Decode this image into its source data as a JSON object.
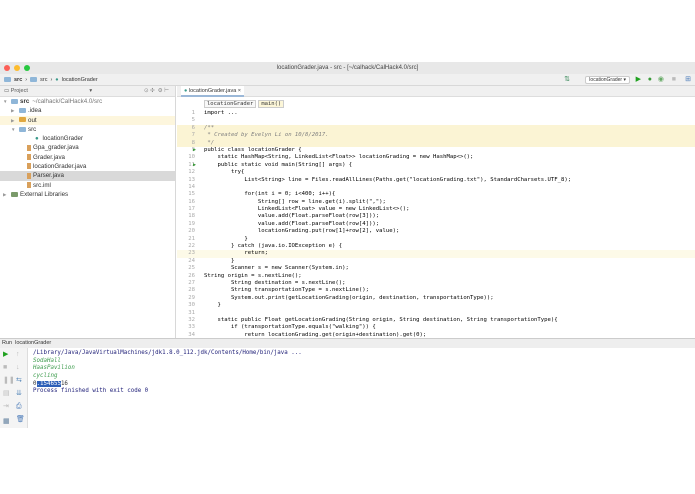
{
  "window": {
    "title": "locationGrader.java - src - [~/calhack/CalHack4.0/src]"
  },
  "navbar": {
    "crumbs": [
      "src",
      "src",
      "locationGrader"
    ],
    "run_config": "locationGrader"
  },
  "project": {
    "header": "Project",
    "tree": [
      {
        "label": "src",
        "suffix": "~/calhack/CalHack4.0/src",
        "indent": 0,
        "type": "folder",
        "arrow": "▼",
        "state": ""
      },
      {
        "label": ".idea",
        "indent": 1,
        "type": "folder",
        "arrow": "▶",
        "state": ""
      },
      {
        "label": "out",
        "indent": 1,
        "type": "folder-orange",
        "arrow": "▶",
        "state": "hl"
      },
      {
        "label": "src",
        "indent": 1,
        "type": "folder",
        "arrow": "▼",
        "state": ""
      },
      {
        "label": "locationGrader",
        "indent": 3,
        "type": "class",
        "arrow": "",
        "state": ""
      },
      {
        "label": "Gpa_grader.java",
        "indent": 2,
        "type": "file",
        "arrow": "",
        "state": ""
      },
      {
        "label": "Grader.java",
        "indent": 2,
        "type": "file",
        "arrow": "",
        "state": ""
      },
      {
        "label": "locationGrader.java",
        "indent": 2,
        "type": "file",
        "arrow": "",
        "state": ""
      },
      {
        "label": "Parser.java",
        "indent": 2,
        "type": "file",
        "arrow": "",
        "state": "sel"
      },
      {
        "label": "src.iml",
        "indent": 2,
        "type": "file",
        "arrow": "",
        "state": ""
      },
      {
        "label": "External Libraries",
        "indent": 0,
        "type": "lib",
        "arrow": "▶",
        "state": ""
      }
    ]
  },
  "editor": {
    "tab": "locationGrader.java",
    "breadcrumbs": [
      "locationGrader",
      "main()"
    ],
    "lines": [
      {
        "n": "1",
        "t": "import ...",
        "k": ""
      },
      {
        "n": "5",
        "t": "",
        "k": ""
      },
      {
        "n": "6",
        "t": "/**",
        "k": "comment"
      },
      {
        "n": "7",
        "t": " * Created by Evelyn Li on 10/8/2017.",
        "k": "comment"
      },
      {
        "n": "8",
        "t": " */",
        "k": "comment"
      },
      {
        "n": "9",
        "t": "public class locationGrader {",
        "k": "",
        "g": "▶"
      },
      {
        "n": "10",
        "t": "    static HashMap<String, LinkedList<Float>> locationGrading = new HashMap<>();",
        "k": ""
      },
      {
        "n": "11",
        "t": "    public static void main(String[] args) {",
        "k": "",
        "g": "▶"
      },
      {
        "n": "12",
        "t": "        try{",
        "k": ""
      },
      {
        "n": "13",
        "t": "            List<String> line = Files.readAllLines(Paths.get(\"locationGrading.txt\"), StandardCharsets.UTF_8);",
        "k": ""
      },
      {
        "n": "14",
        "t": "",
        "k": ""
      },
      {
        "n": "15",
        "t": "            for(int i = 0; i<400; i++){",
        "k": ""
      },
      {
        "n": "16",
        "t": "                String[] row = line.get(i).split(\",\");",
        "k": ""
      },
      {
        "n": "17",
        "t": "                LinkedList<Float> value = new LinkedList<>();",
        "k": ""
      },
      {
        "n": "18",
        "t": "                value.add(Float.parseFloat(row[3]));",
        "k": ""
      },
      {
        "n": "19",
        "t": "                value.add(Float.parseFloat(row[4]));",
        "k": ""
      },
      {
        "n": "20",
        "t": "                locationGrading.put(row[1]+row[2], value);",
        "k": ""
      },
      {
        "n": "21",
        "t": "            }",
        "k": ""
      },
      {
        "n": "22",
        "t": "        } catch (java.io.IOException e) {",
        "k": ""
      },
      {
        "n": "23",
        "t": "            return;",
        "k": "caret"
      },
      {
        "n": "24",
        "t": "        }",
        "k": ""
      },
      {
        "n": "25",
        "t": "        Scanner s = new Scanner(System.in);",
        "k": ""
      },
      {
        "n": "26",
        "t": "String origin = s.nextLine();",
        "k": ""
      },
      {
        "n": "27",
        "t": "        String destination = s.nextLine();",
        "k": ""
      },
      {
        "n": "28",
        "t": "        String transportationType = s.nextLine();",
        "k": ""
      },
      {
        "n": "29",
        "t": "        System.out.print(getLocationGrading(origin, destination, transportationType));",
        "k": ""
      },
      {
        "n": "30",
        "t": "    }",
        "k": ""
      },
      {
        "n": "31",
        "t": "",
        "k": ""
      },
      {
        "n": "32",
        "t": "    static public Float getLocationGrading(String origin, String destination, String transportationType){",
        "k": ""
      },
      {
        "n": "33",
        "t": "        if (transportationType.equals(\"walking\")) {",
        "k": ""
      },
      {
        "n": "34",
        "t": "            return locationGrading.get(origin+destination).get(0);",
        "k": ""
      }
    ]
  },
  "run": {
    "label": "Run",
    "config": "locationGrader",
    "output": {
      "cmd": "/Library/Java/JavaVirtualMachines/jdk1.8.0_112.jdk/Contents/Home/bin/java ...",
      "inputs": [
        "SodaHall",
        "HaasPavilion",
        "cycling"
      ],
      "result_pre": "0",
      "result_sel": ".154655",
      "result_post": "16",
      "exit": "Process finished with exit code 0"
    }
  }
}
